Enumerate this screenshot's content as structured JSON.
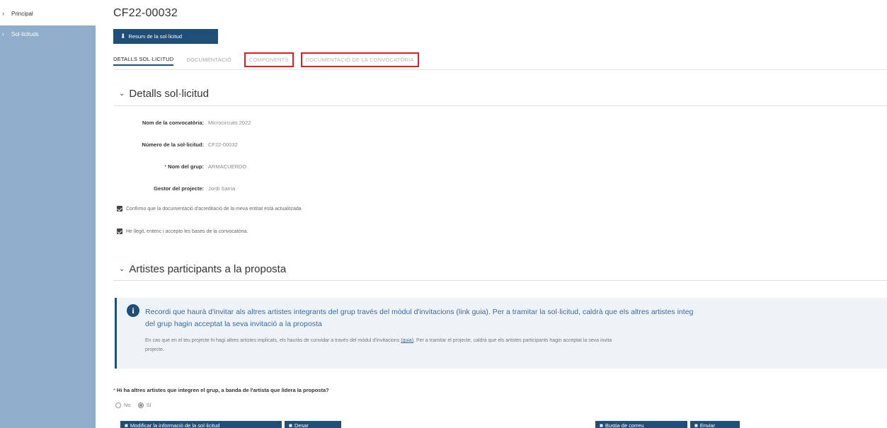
{
  "sidebar": {
    "items": [
      {
        "label": "Principal",
        "bullet": "›"
      },
      {
        "label": "Sol·licituds",
        "bullet": "›"
      }
    ]
  },
  "page": {
    "title": "CF22-00032",
    "summary_button": "Resum de la sol·licitud"
  },
  "tabs": [
    {
      "label": "DETALLS SOL·LICITUD"
    },
    {
      "label": "DOCUMENTACIÓ"
    },
    {
      "label": "COMPONENTS"
    },
    {
      "label": "DOCUMENTACIÓ DE LA CONVOCATÒRIA"
    }
  ],
  "details": {
    "heading": "Detalls sol·licitud",
    "chevron": "⌄",
    "fields": [
      {
        "label": "Nom de la convocatòria:",
        "value": "Microcircuits 2022",
        "required": false
      },
      {
        "label": "Número de la sol·licitud:",
        "value": "CF22-00032",
        "required": false
      },
      {
        "label": "Nom del grup:",
        "value": "ARMACUERDO",
        "required": true
      },
      {
        "label": "Gestor del projecte:",
        "value": "Jordi Sarria",
        "required": false
      }
    ],
    "required_mark": "*",
    "checks": [
      {
        "text": "Confirmo que la documentació d'acreditació de la meva entitat està actualitzada",
        "checked": true
      },
      {
        "text": "He llegit, entenc i accepto les bases de la convocatòria.",
        "checked": true
      }
    ]
  },
  "artists": {
    "heading": "Artistes participants a la proposta",
    "info_icon": "i",
    "info_line1": "Recordi que haurà d'invitar als altres artistes integrants del grup través del mòdul d'invitacions (link guia). Per a tramitar la sol·licitud, caldrà que els altres artistes integ",
    "info_line2": "del grup hagin acceptat la seva invitació a la proposta",
    "sub_before": "En cas que en el teu projecte hi hagi altres artistes implicats, els hauràs de convidar a través del mòdul d'invitacions ",
    "sub_link": "(guia)",
    "sub_after": ". Per a tramitar el projecte, caldrà que els artistes participants hagin acceptat la seva invita",
    "sub_line2": "projecte.",
    "question": "Hi ha altres artistes que integren el grup, a banda de l'artista que lidera la proposta?",
    "options": [
      {
        "label": "No",
        "selected": false
      },
      {
        "label": "Sí",
        "selected": true
      }
    ]
  },
  "bottom_buttons": [
    {
      "label": "Modificar la informació de la sol·licitud",
      "icon": "■"
    },
    {
      "label": "Desar",
      "icon": "■"
    },
    {
      "label": "Bustia de correu",
      "icon": "■"
    },
    {
      "label": "Enviar",
      "icon": "■"
    }
  ]
}
